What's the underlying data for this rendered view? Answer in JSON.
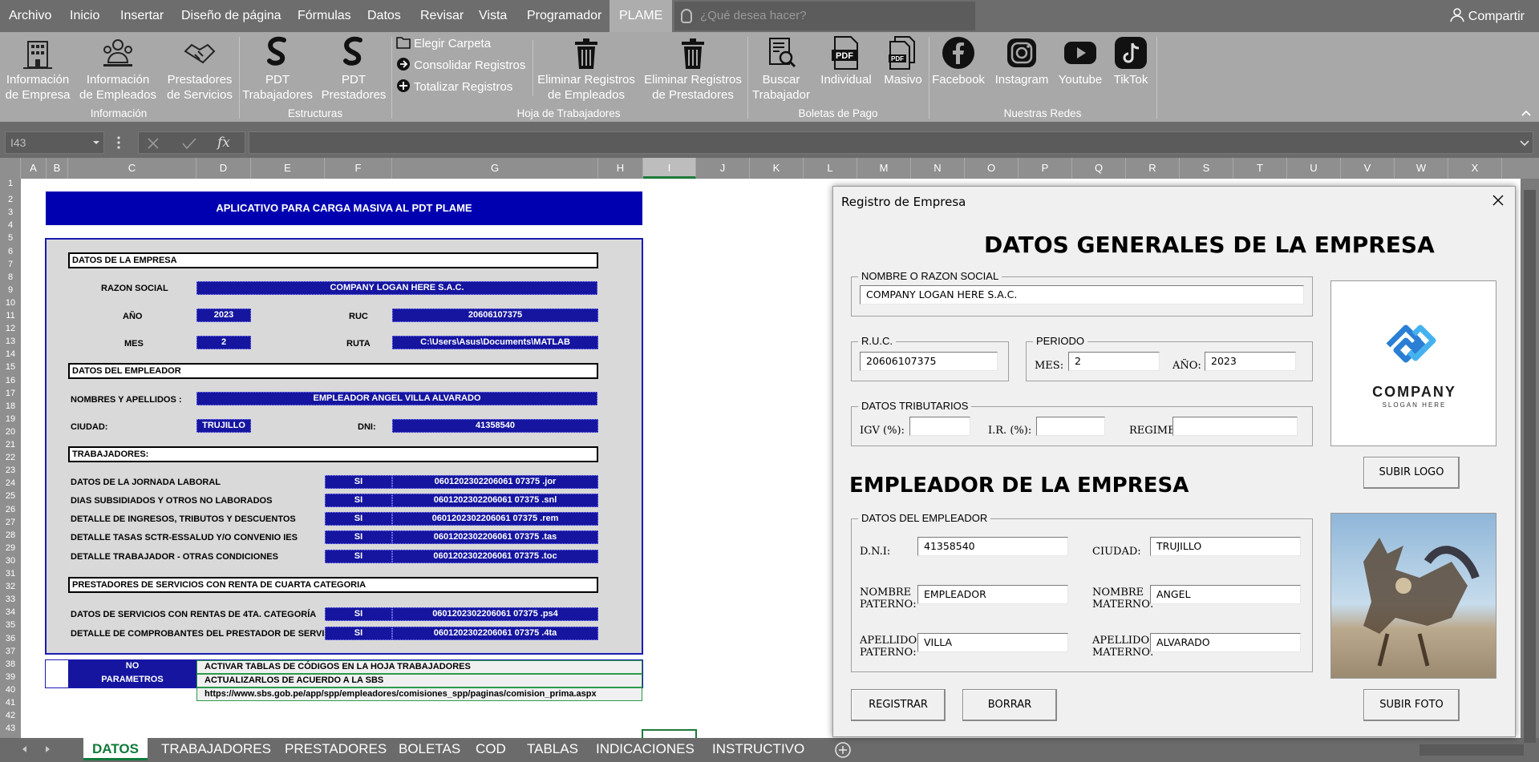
{
  "menu": {
    "items": [
      "Archivo",
      "Inicio",
      "Insertar",
      "Diseño de página",
      "Fórmulas",
      "Datos",
      "Revisar",
      "Vista",
      "Programador"
    ],
    "active": "PLAME",
    "tellme_placeholder": "¿Qué desea hacer?",
    "share": "Compartir"
  },
  "ribbon": {
    "buttons": {
      "info_empresa": [
        "Información",
        "de Empresa"
      ],
      "info_empleados": [
        "Información",
        "de Empleados"
      ],
      "prestadores_servicios": [
        "Prestadores",
        "de Servicios"
      ],
      "pdt_trabajadores": [
        "PDT",
        "Trabajadores"
      ],
      "pdt_prestadores": [
        "PDT",
        "Prestadores"
      ],
      "elegir_carpeta": "Elegir Carpeta",
      "consolidar": "Consolidar Registros",
      "totalizar": "Totalizar Registros",
      "eliminar_empleados": [
        "Eliminar Registros",
        "de Empleados"
      ],
      "eliminar_prestadores": [
        "Eliminar Registros",
        "de Prestadores"
      ],
      "buscar_trabajador": [
        "Buscar",
        "Trabajador"
      ],
      "individual": "Individual",
      "masivo": "Masivo",
      "facebook": "Facebook",
      "instagram": "Instagram",
      "youtube": "Youtube",
      "tiktok": "TikTok"
    },
    "groups": {
      "informacion": "Información",
      "estructuras": "Estructuras",
      "hoja": "Hoja de Trabajadores",
      "boletas": "Boletas de Pago",
      "redes": "Nuestras Redes"
    }
  },
  "formula_bar": {
    "name_box": "I43",
    "fx": "fx",
    "formula": ""
  },
  "columns": [
    "A",
    "B",
    "C",
    "D",
    "E",
    "F",
    "G",
    "H",
    "I",
    "J",
    "K",
    "L",
    "M",
    "N",
    "O",
    "P",
    "Q",
    "R",
    "S",
    "T",
    "U",
    "V",
    "W",
    "X"
  ],
  "rows": [
    "1",
    "2",
    "3",
    "4",
    "5",
    "6",
    "7",
    "8",
    "9",
    "10",
    "11",
    "12",
    "13",
    "14",
    "15",
    "16",
    "17",
    "18",
    "19",
    "20",
    "21",
    "22",
    "23",
    "24",
    "25",
    "26",
    "27",
    "28",
    "29",
    "30",
    "31",
    "32",
    "33",
    "34",
    "35",
    "36",
    "37",
    "38",
    "39",
    "40",
    "41",
    "42",
    "43"
  ],
  "sheet": {
    "title": "APLICATIVO PARA CARGA MASIVA AL PDT PLAME",
    "sec_empresa": "DATOS DE LA EMPRESA",
    "razon_label": "RAZON SOCIAL",
    "razon_value": "COMPANY LOGAN HERE S.A.C.",
    "anio_label": "AÑO",
    "anio_value": "2023",
    "ruc_label": "RUC",
    "ruc_value": "20606107375",
    "mes_label": "MES",
    "mes_value": "2",
    "ruta_label": "RUTA",
    "ruta_value": "C:\\Users\\Asus\\Documents\\MATLAB",
    "sec_empleador": "DATOS DEL EMPLEADOR",
    "nombres_label": "NOMBRES Y APELLIDOS :",
    "nombres_value": "EMPLEADOR ANGEL VILLA ALVARADO",
    "ciudad_label": "CIUDAD:",
    "ciudad_value": "TRUJILLO",
    "dni_label": "DNI:",
    "dni_value": "41358540",
    "sec_trabajadores": "TRABAJADORES:",
    "trabajadores": [
      {
        "label": "DATOS DE LA JORNADA LABORAL",
        "si": "SI",
        "file": "0601202302206061 07375 .jor"
      },
      {
        "label": "DIAS SUBSIDIADOS Y OTROS NO LABORADOS",
        "si": "SI",
        "file": "0601202302206061 07375 .snl"
      },
      {
        "label": "DETALLE DE INGRESOS, TRIBUTOS Y DESCUENTOS",
        "si": "SI",
        "file": "0601202302206061 07375 .rem"
      },
      {
        "label": "DETALLE TASAS SCTR-ESSALUD Y/O CONVENIO IES",
        "si": "SI",
        "file": "0601202302206061 07375 .tas"
      },
      {
        "label": "DETALLE TRABAJADOR - OTRAS CONDICIONES",
        "si": "SI",
        "file": "0601202302206061 07375 .toc"
      }
    ],
    "sec_prestadores": "PRESTADORES DE SERVICIOS CON RENTA DE CUARTA CATEGORIA",
    "prestadores": [
      {
        "label": "DATOS DE SERVICIOS CON RENTAS DE 4TA. CATEGORÍA",
        "si": "SI",
        "file": "0601202302206061 07375 .ps4"
      },
      {
        "label": "DETALLE DE COMPROBANTES DEL PRESTADOR DE SERVICIO",
        "si": "SI",
        "file": "0601202302206061 07375 .4ta"
      }
    ],
    "no_value": "NO",
    "no_text": "ACTIVAR TABLAS DE CÓDIGOS EN LA HOJA TRABAJADORES",
    "param_value": "PARAMETROS",
    "param_text": "ACTUALIZARLOS DE ACUERDO A LA SBS",
    "url": "https://www.sbs.gob.pe/app/spp/empleadores/comisiones_spp/paginas/comision_prima.aspx"
  },
  "tabs": [
    "DATOS",
    "TRABAJADORES",
    "PRESTADORES",
    "BOLETAS",
    "COD",
    "TABLAS",
    "INDICACIONES",
    "INSTRUCTIVO"
  ],
  "dialog": {
    "title": "Registro de Empresa",
    "heading": "DATOS GENERALES DE LA EMPRESA",
    "razon_legend": "NOMBRE O RAZON SOCIAL",
    "razon_value": "COMPANY LOGAN HERE S.A.C.",
    "ruc_legend": "R.U.C.",
    "ruc_value": "20606107375",
    "periodo_legend": "PERIODO",
    "mes_label": "MES:",
    "mes_value": "2",
    "anio_label": "AÑO:",
    "anio_value": "2023",
    "trib_legend": "DATOS TRIBUTARIOS",
    "igv_label": "IGV (%):",
    "igv_value": "",
    "ir_label": "I.R. (%):",
    "ir_value": "",
    "regimen_label": "REGIMEN:",
    "regimen_value": "",
    "logo_text": "COMPANY",
    "logo_slogan": "SLOGAN HERE",
    "subir_logo": "SUBIR LOGO",
    "empleador_heading": "EMPLEADOR DE LA EMPRESA",
    "emp_legend": "DATOS DEL EMPLEADOR",
    "dni_label": "D.N.I:",
    "dni_value": "41358540",
    "ciudad_label": "CIUDAD:",
    "ciudad_value": "TRUJILLO",
    "npat_label": [
      "NOMBRE",
      "PATERNO:"
    ],
    "npat_value": "EMPLEADOR",
    "nmat_label": [
      "NOMBRE",
      "MATERNO:"
    ],
    "nmat_value": "ANGEL",
    "apat_label": [
      "APELLIDO",
      "PATERNO:"
    ],
    "apat_value": "VILLA",
    "amat_label": [
      "APELLIDO",
      "MATERNO:"
    ],
    "amat_value": "ALVARADO",
    "registrar": "REGISTRAR",
    "borrar": "BORRAR",
    "subir_foto": "SUBIR FOTO"
  }
}
